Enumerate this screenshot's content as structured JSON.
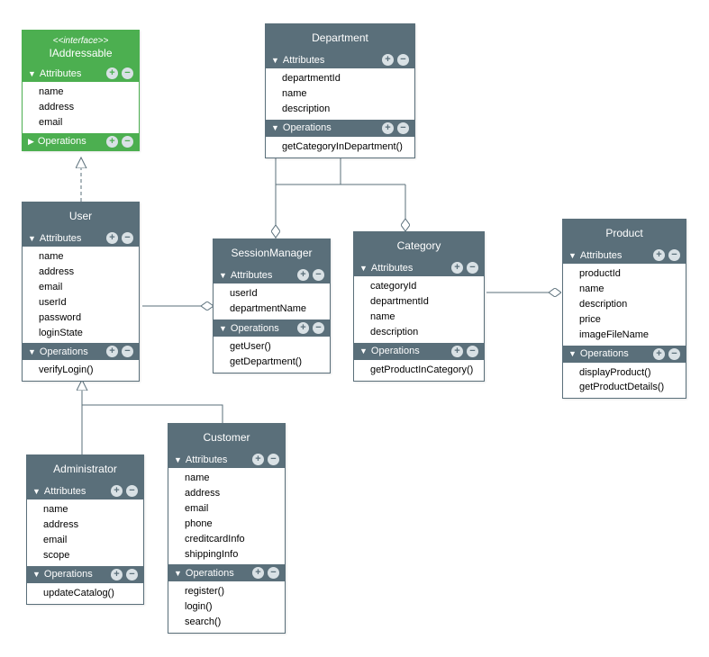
{
  "labels": {
    "attributes": "Attributes",
    "operations": "Operations"
  },
  "arrows": {
    "down": "▼",
    "right": "▶"
  },
  "classes": {
    "iaddressable": {
      "stereotype": "<<interface>>",
      "name": "IAddressable",
      "attributes": [
        "name",
        "address",
        "email"
      ],
      "operations": []
    },
    "department": {
      "name": "Department",
      "attributes": [
        "departmentId",
        "name",
        "description"
      ],
      "operations": [
        "getCategoryInDepartment()"
      ]
    },
    "user": {
      "name": "User",
      "attributes": [
        "name",
        "address",
        "email",
        "userId",
        "password",
        "loginState"
      ],
      "operations": [
        "verifyLogin()"
      ]
    },
    "sessionmanager": {
      "name": "SessionManager",
      "attributes": [
        "userId",
        "departmentName"
      ],
      "operations": [
        "getUser()",
        "getDepartment()"
      ]
    },
    "category": {
      "name": "Category",
      "attributes": [
        "categoryId",
        "departmentId",
        "name",
        "description"
      ],
      "operations": [
        "getProductInCategory()"
      ]
    },
    "product": {
      "name": "Product",
      "attributes": [
        "productId",
        "name",
        "description",
        "price",
        "imageFileName"
      ],
      "operations": [
        "displayProduct()",
        "getProductDetails()"
      ]
    },
    "administrator": {
      "name": "Administrator",
      "attributes": [
        "name",
        "address",
        "email",
        "scope"
      ],
      "operations": [
        "updateCatalog()"
      ]
    },
    "customer": {
      "name": "Customer",
      "attributes": [
        "name",
        "address",
        "email",
        "phone",
        "creditcardInfo",
        "shippingInfo"
      ],
      "operations": [
        "register()",
        "login()",
        "search()"
      ]
    }
  },
  "chart_data": {
    "type": "table",
    "title": "UML Class Diagram",
    "classes": [
      {
        "name": "IAddressable",
        "stereotype": "interface",
        "attributes": [
          "name",
          "address",
          "email"
        ],
        "operations": [],
        "color": "green"
      },
      {
        "name": "Department",
        "attributes": [
          "departmentId",
          "name",
          "description"
        ],
        "operations": [
          "getCategoryInDepartment()"
        ]
      },
      {
        "name": "User",
        "attributes": [
          "name",
          "address",
          "email",
          "userId",
          "password",
          "loginState"
        ],
        "operations": [
          "verifyLogin()"
        ]
      },
      {
        "name": "SessionManager",
        "attributes": [
          "userId",
          "departmentName"
        ],
        "operations": [
          "getUser()",
          "getDepartment()"
        ]
      },
      {
        "name": "Category",
        "attributes": [
          "categoryId",
          "departmentId",
          "name",
          "description"
        ],
        "operations": [
          "getProductInCategory()"
        ]
      },
      {
        "name": "Product",
        "attributes": [
          "productId",
          "name",
          "description",
          "price",
          "imageFileName"
        ],
        "operations": [
          "displayProduct()",
          "getProductDetails()"
        ]
      },
      {
        "name": "Administrator",
        "attributes": [
          "name",
          "address",
          "email",
          "scope"
        ],
        "operations": [
          "updateCatalog()"
        ]
      },
      {
        "name": "Customer",
        "attributes": [
          "name",
          "address",
          "email",
          "phone",
          "creditcardInfo",
          "shippingInfo"
        ],
        "operations": [
          "register()",
          "login()",
          "search()"
        ]
      }
    ],
    "relationships": [
      {
        "from": "User",
        "to": "IAddressable",
        "type": "realization"
      },
      {
        "from": "Administrator",
        "to": "User",
        "type": "generalization"
      },
      {
        "from": "Customer",
        "to": "User",
        "type": "generalization"
      },
      {
        "from": "SessionManager",
        "to": "User",
        "type": "aggregation"
      },
      {
        "from": "SessionManager",
        "to": "Department",
        "type": "aggregation"
      },
      {
        "from": "Category",
        "to": "Department",
        "type": "aggregation"
      },
      {
        "from": "Product",
        "to": "Category",
        "type": "aggregation"
      }
    ]
  }
}
